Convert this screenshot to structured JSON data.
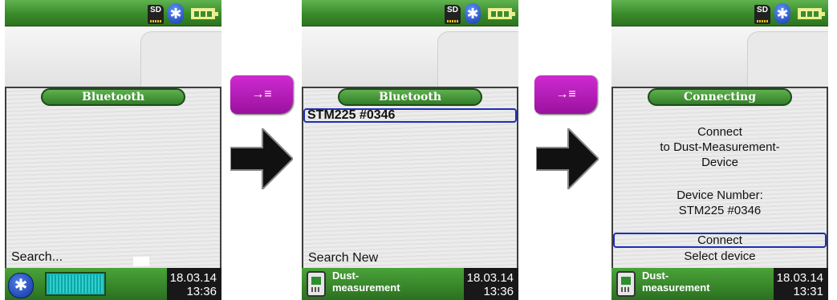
{
  "status": {
    "sd_label": "SD",
    "bluetooth_symbol": "✱"
  },
  "screens": [
    {
      "heading": "Bluetooth",
      "lower_text": "Search...",
      "date": "18.03.14",
      "time": "13:36"
    },
    {
      "heading": "Bluetooth",
      "device_item": "STM225 #0346",
      "lower_text": "Search New",
      "device_label_1": "Dust-",
      "device_label_2": "measurement",
      "date": "18.03.14",
      "time": "13:36"
    },
    {
      "heading": "Connecting",
      "line1": "Connect",
      "line2": "to Dust-Measurement-",
      "line3": "Device",
      "line4": "Device Number:",
      "line5": "STM225 #0346",
      "connect_label": "Connect",
      "select_label": "Select device",
      "device_label_1": "Dust-",
      "device_label_2": "measurement",
      "date": "18.03.14",
      "time": "13:31"
    }
  ],
  "keys": {
    "enter_symbol": "→≡"
  },
  "colors": {
    "status_green": "#3a8a2b",
    "selection_blue": "#1e2fb5",
    "key_purple": "#b91bbd",
    "progress_teal": "#17b8b8"
  }
}
